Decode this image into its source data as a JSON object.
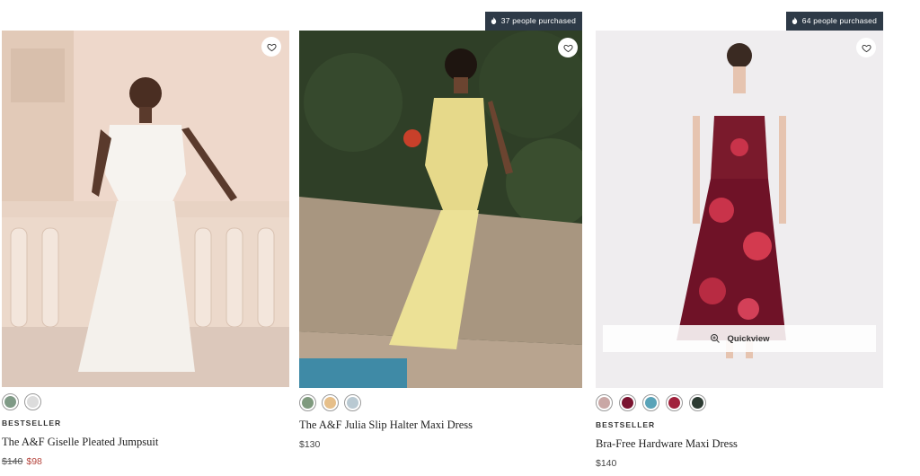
{
  "products": [
    {
      "purchased": "",
      "badge": "BESTSELLER",
      "name": "The A&F Giselle Pleated Jumpsuit",
      "price_original": "$140",
      "price_sale": "$98",
      "swatches": [
        "#7f9a86",
        "#dcdcdc"
      ],
      "image": "woman in white pleated jumpsuit on balcony"
    },
    {
      "purchased": "37 people purchased",
      "badge": "",
      "name": "The A&F Julia Slip Halter Maxi Dress",
      "price": "$130",
      "swatches": [
        "#7f9a7e",
        "#e6bf8a",
        "#b9c9d2"
      ],
      "image": "woman in yellow satin halter dress by wall"
    },
    {
      "purchased": "64 people purchased",
      "badge": "BESTSELLER",
      "name": "Bra-Free Hardware Maxi Dress",
      "price": "$140",
      "quickview": "Quickview",
      "swatches": [
        "#c9a7a5",
        "#7a1430",
        "#5aa3b8",
        "#a0213c",
        "#2c3a32"
      ],
      "image": "woman in red floral maxi dress"
    }
  ],
  "icons": {
    "favorite": "heart-icon",
    "flame": "flame-icon",
    "zoom": "zoom-in-icon"
  }
}
